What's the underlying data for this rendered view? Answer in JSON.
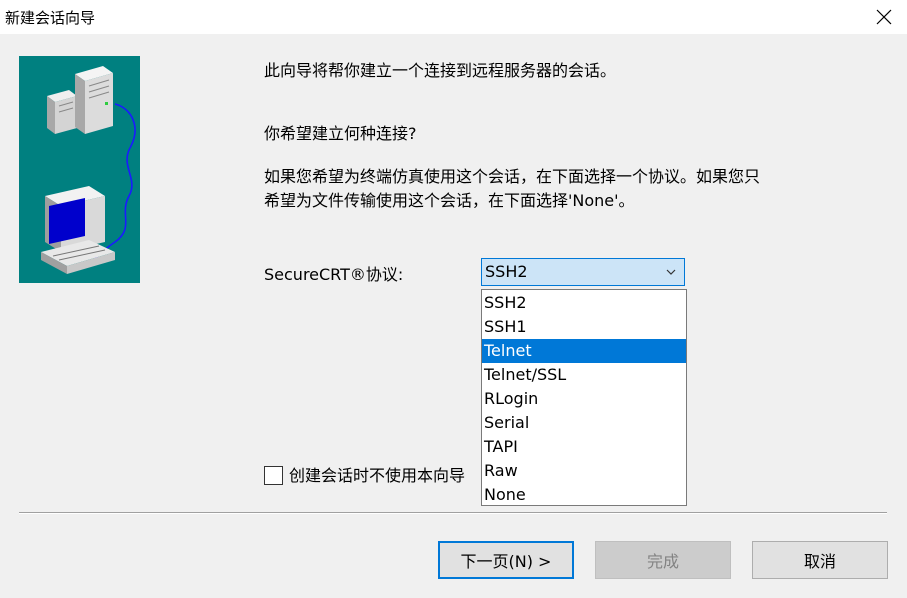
{
  "window": {
    "title": "新建会话向导",
    "close_icon": "close-icon"
  },
  "illustration": {
    "background_color": "#008080",
    "icons": [
      "server-tower-icon",
      "computer-monitor-icon",
      "network-cable-icon"
    ]
  },
  "content": {
    "intro": "此向导将帮你建立一个连接到远程服务器的会话。",
    "question": "你希望建立何种连接?",
    "description_line1": "如果您希望为终端仿真使用这个会话，在下面选择一个协议。如果您只",
    "description_line2": "希望为文件传输使用这个会话，在下面选择'None'。"
  },
  "protocol": {
    "label": "SecureCRT®协议:",
    "selected_value": "SSH2",
    "highlighted_option": "Telnet",
    "options": [
      "SSH2",
      "SSH1",
      "Telnet",
      "Telnet/SSL",
      "RLogin",
      "Serial",
      "TAPI",
      "Raw",
      "None"
    ]
  },
  "option_checkbox": {
    "checked": false,
    "label_visible": "创建会话时不使用本向导"
  },
  "buttons": {
    "next": "下一页(N) >",
    "finish": "完成",
    "cancel": "取消"
  },
  "colors": {
    "accent": "#0078d7",
    "illustration_bg": "#008080",
    "disabled_text": "#838383"
  }
}
